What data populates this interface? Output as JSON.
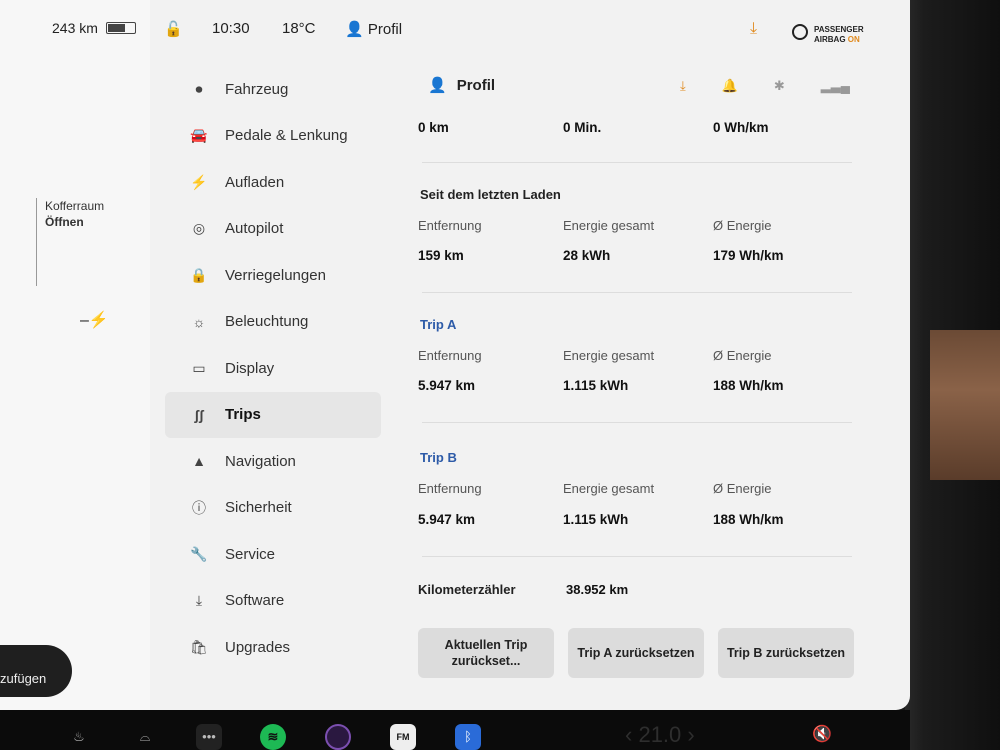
{
  "car": {
    "range": "243 km",
    "trunk_label": "Kofferraum",
    "trunk_action": "Öffnen",
    "add_button": "zufügen"
  },
  "status": {
    "time": "10:30",
    "temperature": "18°C",
    "profile": "Profil",
    "airbag_line1": "PASSENGER",
    "airbag_line2": "AIRBAG",
    "airbag_state": "ON"
  },
  "menu": {
    "items": [
      {
        "label": "Fahrzeug",
        "icon": "toggle-icon"
      },
      {
        "label": "Pedale & Lenkung",
        "icon": "car-icon"
      },
      {
        "label": "Aufladen",
        "icon": "bolt-icon"
      },
      {
        "label": "Autopilot",
        "icon": "steering-wheel-icon"
      },
      {
        "label": "Verriegelungen",
        "icon": "lock-icon"
      },
      {
        "label": "Beleuchtung",
        "icon": "light-icon"
      },
      {
        "label": "Display",
        "icon": "display-icon"
      },
      {
        "label": "Trips",
        "icon": "trips-icon",
        "active": true
      },
      {
        "label": "Navigation",
        "icon": "navigation-icon"
      },
      {
        "label": "Sicherheit",
        "icon": "alert-icon"
      },
      {
        "label": "Service",
        "icon": "wrench-icon"
      },
      {
        "label": "Software",
        "icon": "download-icon"
      },
      {
        "label": "Upgrades",
        "icon": "bag-icon"
      }
    ]
  },
  "content": {
    "header": "Profil",
    "top_row": {
      "distance": "0 km",
      "time": "0 Min.",
      "energy": "0 Wh/km"
    },
    "since_charge": {
      "title": "Seit dem letzten Laden",
      "label_distance": "Entfernung",
      "label_energy_total": "Energie gesamt",
      "label_avg": "Ø Energie",
      "distance": "159 km",
      "energy_total": "28 kWh",
      "avg": "179 Wh/km"
    },
    "trip_a": {
      "title": "Trip A",
      "label_distance": "Entfernung",
      "label_energy_total": "Energie gesamt",
      "label_avg": "Ø Energie",
      "distance": "5.947 km",
      "energy_total": "1.115 kWh",
      "avg": "188 Wh/km"
    },
    "trip_b": {
      "title": "Trip B",
      "label_distance": "Entfernung",
      "label_energy_total": "Energie gesamt",
      "label_avg": "Ø Energie",
      "distance": "5.947 km",
      "energy_total": "1.115 kWh",
      "avg": "188 Wh/km"
    },
    "odometer_label": "Kilometerzähler",
    "odometer_value": "38.952 km",
    "buttons": {
      "reset_current": "Aktuellen Trip zurückset...",
      "reset_a": "Trip A zurücksetzen",
      "reset_b": "Trip B zurücksetzen"
    }
  },
  "dock": {
    "temperature": "21.0",
    "fm_label": "FM"
  },
  "colors": {
    "accent_orange": "#e08a1e",
    "trip_blue": "#2d5ba8",
    "spotify_green": "#1db954",
    "bluetooth_blue": "#2a6bd8"
  }
}
